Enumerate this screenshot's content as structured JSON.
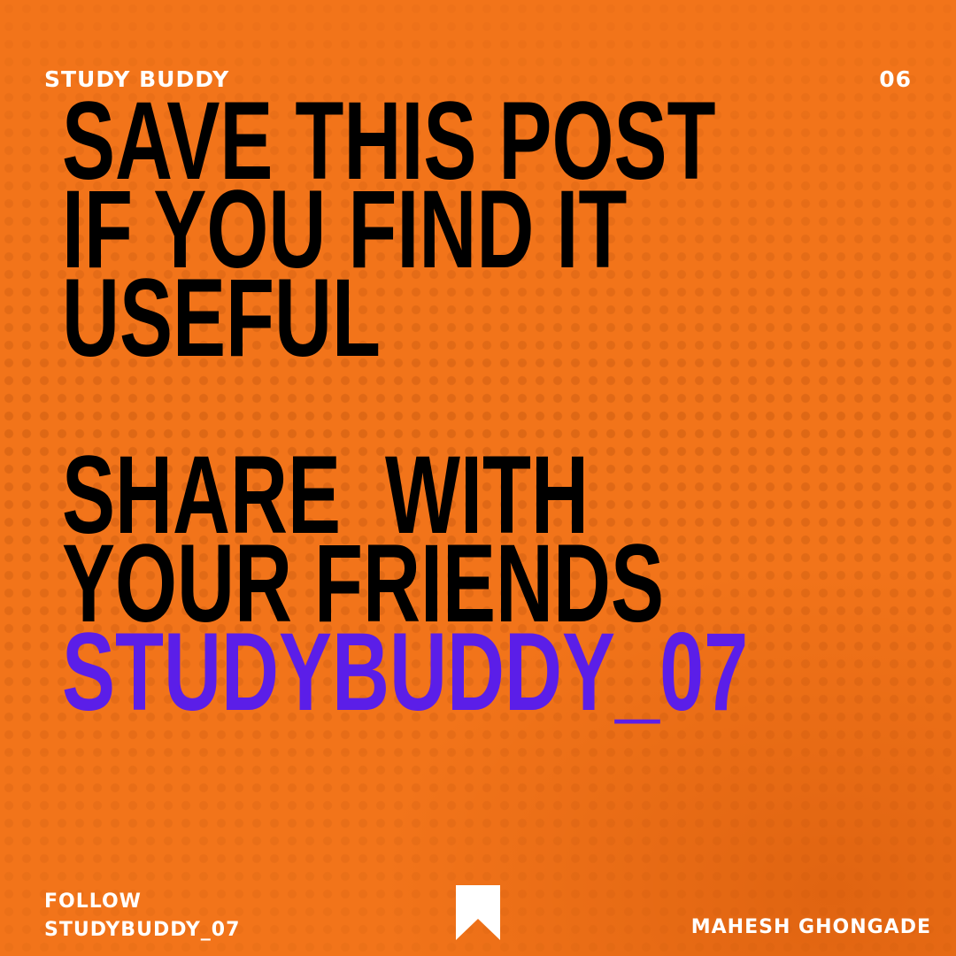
{
  "header": {
    "brand": "STUDY BUDDY",
    "page_number": "06"
  },
  "headline": {
    "lines": [
      "SAVE THIS POST",
      "IF YOU FIND IT",
      "USEFUL",
      "",
      "SHARE  WITH",
      "YOUR FRIENDS"
    ],
    "handle": "STUDYBUDDY_07"
  },
  "footer": {
    "follow_label": "FOLLOW",
    "follow_handle": "STUDYBUDDY_07",
    "author": "MAHESH GHONGADE",
    "icon": "bookmark-icon"
  },
  "colors": {
    "background": "#f2741a",
    "headline": "#000000",
    "handle": "#5b1ee8",
    "small_text": "#ffffff"
  }
}
